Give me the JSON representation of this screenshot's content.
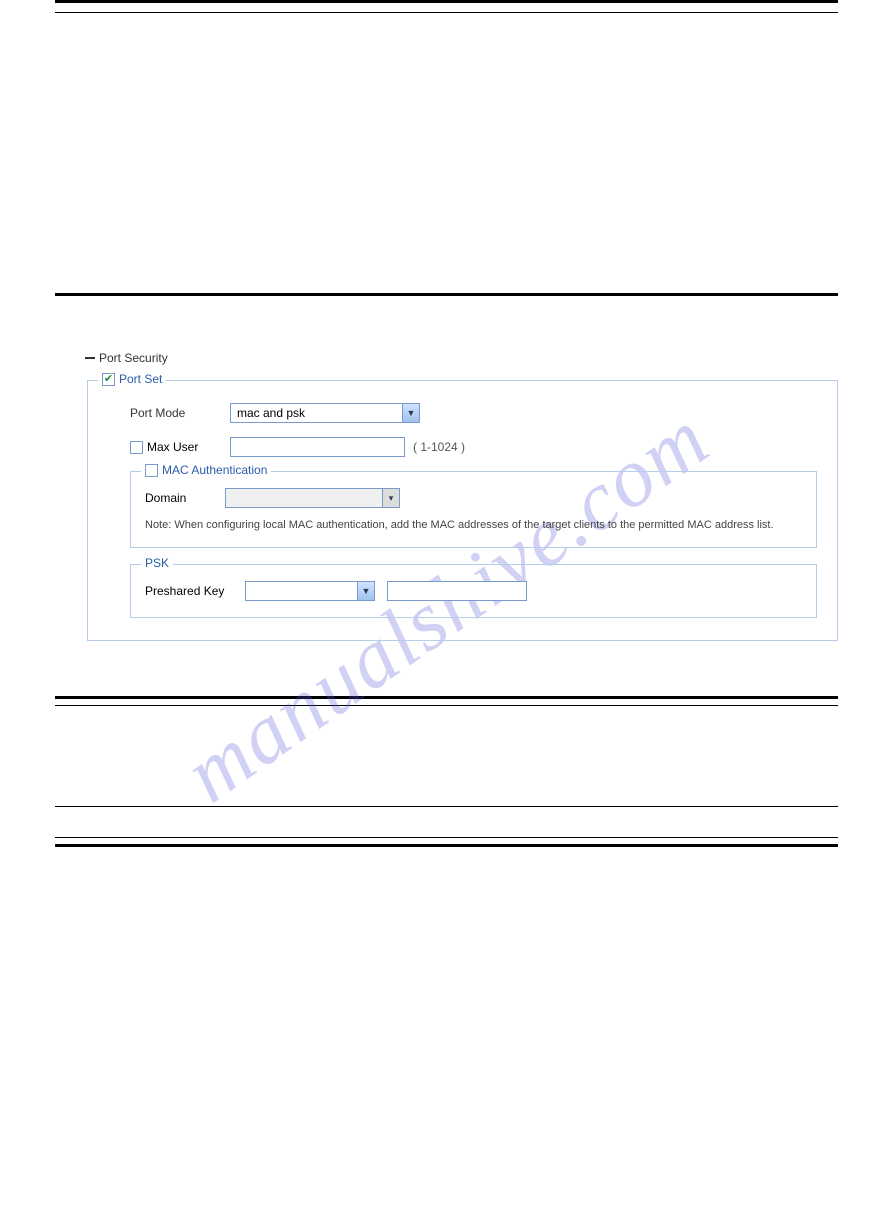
{
  "watermark": "manualshive.com",
  "section": {
    "title": "Port Security",
    "port_set_legend": "Port Set",
    "port_mode_label": "Port Mode",
    "port_mode_value": "mac and psk",
    "max_user_label": "Max User",
    "max_user_hint": "( 1-1024 )",
    "mac_auth_legend": "MAC Authentication",
    "domain_label": "Domain",
    "mac_note": "Note: When configuring local MAC authentication, add the MAC addresses of the target clients to the permitted MAC address list.",
    "psk_legend": "PSK",
    "preshared_label": "Preshared Key"
  }
}
